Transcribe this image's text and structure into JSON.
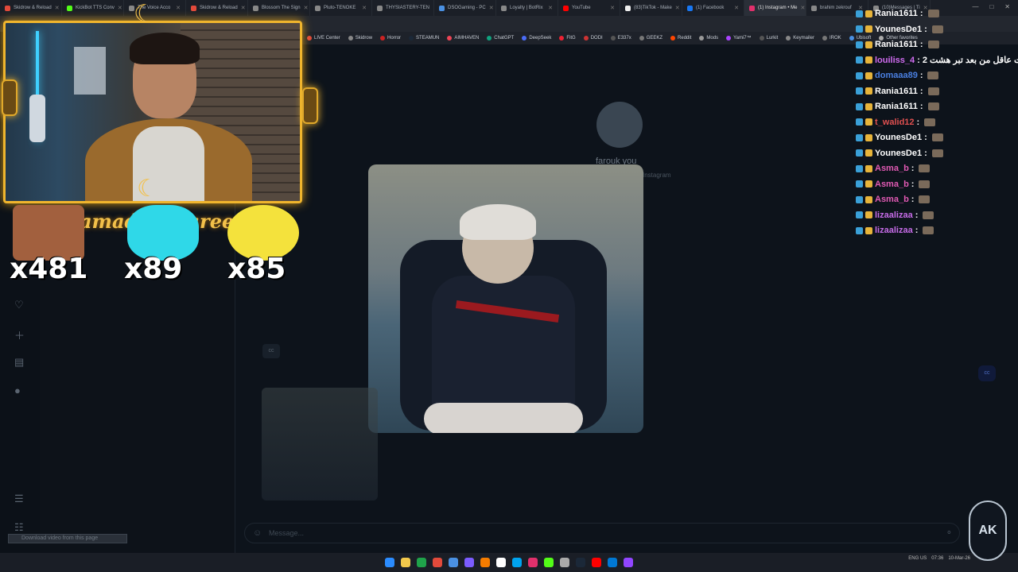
{
  "tabs": [
    {
      "label": "Skidrow & Reload",
      "color": "#e24a3b"
    },
    {
      "label": "KickBot TTS Conv",
      "color": "#53fc18"
    },
    {
      "label": "The Voice Acco",
      "color": "#888"
    },
    {
      "label": "Skidrow & Reload",
      "color": "#e24a3b"
    },
    {
      "label": "Blossom The Sign",
      "color": "#888"
    },
    {
      "label": "Pluto-TENOKE",
      "color": "#888"
    },
    {
      "label": "THYSIASTERY-TEN",
      "color": "#888"
    },
    {
      "label": "DSOGaming - PC",
      "color": "#4a90e2"
    },
    {
      "label": "Loyalty | BotRix",
      "color": "#888"
    },
    {
      "label": "YouTube",
      "color": "#ff0000"
    },
    {
      "label": "(83)TikTok - Make",
      "color": "#eee"
    },
    {
      "label": "(1) Facebook",
      "color": "#1877f2"
    },
    {
      "label": "(1) Instagram • Me",
      "color": "#e1306c"
    },
    {
      "label": "brahim zekrouf",
      "color": "#888"
    },
    {
      "label": "(10)Messages | Ti",
      "color": "#888"
    }
  ],
  "bookmarks": [
    "LIVE Center",
    "Skidrow",
    "Horror",
    "STEAMUN",
    "AIMHAVEN",
    "ChatGPT",
    "DeepSeek",
    "FitG",
    "DODI",
    "E337x",
    "GEEKZ",
    "Reddit",
    "Mods",
    "Yami7™",
    "Lurkit",
    "Keymailer",
    "IROK",
    "Ubisoft",
    "Other favorites"
  ],
  "overlay": {
    "ramadan": "amadan Kareem",
    "emote_counts": [
      "x481",
      "x89",
      "x85"
    ]
  },
  "conversation": {
    "username": "farouk you",
    "subtitle": "Instagram",
    "message_placeholder": "Message...",
    "cc1": "cc",
    "cc2": "cc"
  },
  "download_bar": "Download video from this page",
  "chat": [
    {
      "user": "Rania1611",
      "text": "",
      "color": "#ffffff"
    },
    {
      "user": "YounesDe1",
      "text": "",
      "color": "#ffffff"
    },
    {
      "user": "Rania1611",
      "text": "",
      "color": "#ffffff"
    },
    {
      "user": "louiliss_4",
      "text": "انا كنت عاقل من بعد تبر هشت 2tts",
      "color": "#d06cf0"
    },
    {
      "user": "domaaa89",
      "text": "",
      "color": "#4a7fe0"
    },
    {
      "user": "Rania1611",
      "text": "",
      "color": "#ffffff"
    },
    {
      "user": "Rania1611",
      "text": "",
      "color": "#ffffff"
    },
    {
      "user": "t_walid12",
      "text": "",
      "color": "#e05050"
    },
    {
      "user": "YounesDe1",
      "text": "",
      "color": "#ffffff"
    },
    {
      "user": "YounesDe1",
      "text": "",
      "color": "#ffffff"
    },
    {
      "user": "Asma_b",
      "text": "",
      "color": "#e25ab4"
    },
    {
      "user": "Asma_b",
      "text": "",
      "color": "#e25ab4"
    },
    {
      "user": "Asma_b",
      "text": "",
      "color": "#e25ab4"
    },
    {
      "user": "lizaalizaa",
      "text": "",
      "color": "#c66ce8"
    },
    {
      "user": "lizaalizaa",
      "text": "",
      "color": "#c66ce8"
    }
  ],
  "logo": "AK",
  "tray": {
    "lang": "ENG US",
    "time": "07:36",
    "date": "10-Mar-26"
  }
}
